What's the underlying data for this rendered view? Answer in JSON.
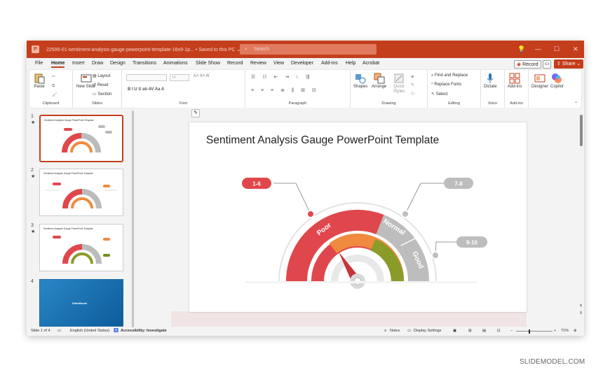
{
  "titlebar": {
    "app_logo": "P",
    "filename": "22596-01-sentiment-analysis-gauge-powerpoint-template-16x9-1p... • Saved to this PC ⌄",
    "search_placeholder": "Search",
    "controls": {
      "lightbulb": "💡",
      "minimize": "—",
      "maximize": "☐",
      "close": "✕"
    }
  },
  "menu": {
    "items": [
      "File",
      "Home",
      "Insert",
      "Draw",
      "Design",
      "Transitions",
      "Animations",
      "Slide Show",
      "Record",
      "Review",
      "View",
      "Developer",
      "Add-ins",
      "Help",
      "Acrobat"
    ],
    "record_label": "Record",
    "share_label": "Share"
  },
  "ribbon": {
    "clipboard": {
      "paste": "Paste",
      "group": "Clipboard"
    },
    "slides": {
      "new_slide": "New Slide",
      "layout": "Layout",
      "reset": "Reset",
      "section": "Section",
      "group": "Slides"
    },
    "font": {
      "group": "Font",
      "size": "14",
      "styles": "B  I  U  S  ab  AV  Aa  A",
      "grow_shrink": "A˄ A˅ A̸"
    },
    "paragraph": {
      "group": "Paragraph"
    },
    "drawing": {
      "shapes": "Shapes",
      "arrange": "Arrange",
      "quick_styles": "Quick Styles",
      "group": "Drawing"
    },
    "editing": {
      "find_replace": "Find and Replace",
      "replace_fonts": "Replace Fonts",
      "select": "Select",
      "group": "Editing"
    },
    "voice": {
      "dictate": "Dictate",
      "group": "Voice"
    },
    "addins": {
      "addins": "Add-ins",
      "group": "Add-ins"
    },
    "designer": "Designer",
    "copilot": "Copilot"
  },
  "thumbnails": [
    {
      "num": "1",
      "star": "★",
      "title": "Sentiment Analysis Gauge PowerPoint Template"
    },
    {
      "num": "2",
      "star": "★",
      "title": "Sentiment Analysis Gauge PowerPoint Template"
    },
    {
      "num": "3",
      "star": "★",
      "title": "Sentiment Analysis Gauge PowerPoint Template"
    },
    {
      "num": "4",
      "star": "",
      "title": "SlideModel"
    }
  ],
  "slide": {
    "title": "Sentiment Analysis Gauge PowerPoint Template",
    "labels": {
      "poor": "Poor",
      "normal": "Normal",
      "good": "Good"
    },
    "callouts": {
      "low": "1-6",
      "mid": "7-8",
      "high": "9-10"
    },
    "colors": {
      "red": "#e0474c",
      "gray": "#b3b3b3",
      "orange": "#f08a3e",
      "olive": "#8a9b2a"
    }
  },
  "status": {
    "slide_of": "Slide 1 of 4",
    "language": "English (United States)",
    "accessibility": "Accessibility: Investigate",
    "notes": "Notes",
    "display": "Display Settings",
    "zoom": "71%"
  },
  "watermark": "SLIDEMODEL.COM"
}
